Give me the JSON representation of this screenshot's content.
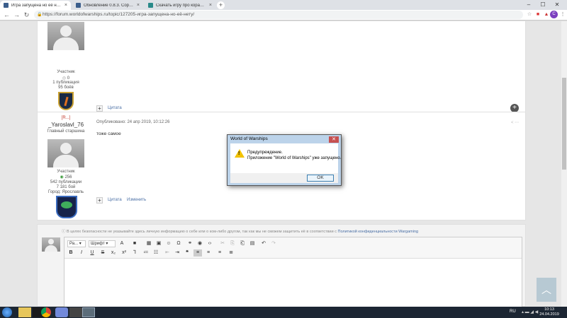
{
  "browser": {
    "tabs": [
      {
        "title": "Игра запущена но её нету. - То...",
        "active": true
      },
      {
        "title": "Обновление 0.8.3. Соревнова...",
        "active": false
      },
      {
        "title": "Скачать игру про корабли Wor...",
        "active": false
      }
    ],
    "new_tab": "+",
    "url": "https://forum.worldofwarships.ru/topic/127205-игра-запущена-но-её-нету/",
    "window_controls": [
      "–",
      "☐",
      "✕"
    ]
  },
  "post1": {
    "rank": "Участник",
    "reputation": "0",
    "publications": "1 публикация",
    "battles": "95 боёв",
    "quote_label": "Цитата"
  },
  "post2": {
    "clan_tag": "[R...]",
    "username": "_Yaroslavl_76",
    "title": "Главный старшина",
    "posted": "Опубликовано: 24 апр 2019, 10:12:26",
    "content": "тоже самое",
    "rank": "Участник",
    "reputation": "256",
    "publications": "542 публикации",
    "battles": "7 181 бой",
    "city": "Город: Ярославль",
    "quote_label": "Цитата",
    "edit_label": "Изменить"
  },
  "dialog": {
    "title": "World of Warships",
    "line1": "Предупреждение.",
    "line2": "Приложение \"World of Warships\" уже запущено.",
    "ok": "OK",
    "close": "✕"
  },
  "editor": {
    "notice": "В целях безопасности не указывайте здесь личную информацию о себе или о ком-либо другом, так как мы не сможем защитить её в соответствии с",
    "notice_link": "Политикой конфиденциальности Wargaming",
    "style_select": "Ра...",
    "font_select": "Шрифт"
  },
  "taskbar": {
    "lang": "RU",
    "time": "10:13",
    "date": "24.04.2019"
  },
  "colors": {
    "accent": "#4a6fa5",
    "taskbar": "#1c2633",
    "dialog_frame": "#bcd3ea"
  }
}
